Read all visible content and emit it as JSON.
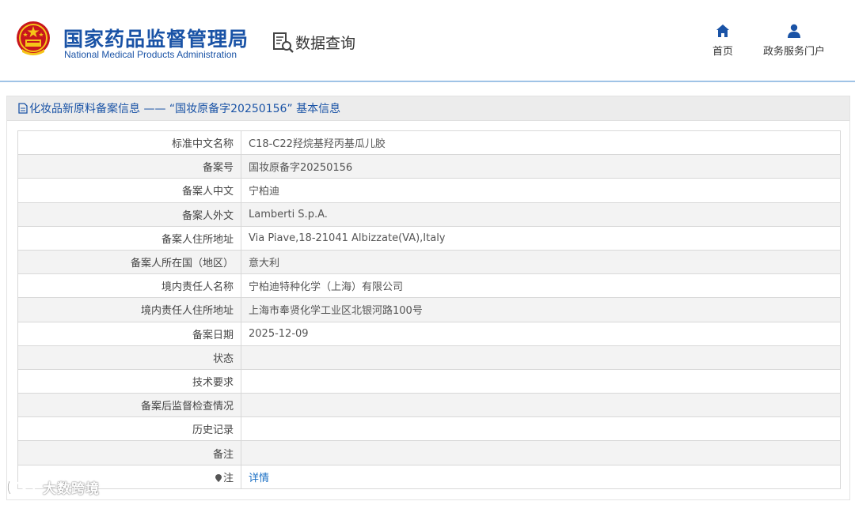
{
  "header": {
    "brand_cn": "国家药品监督管理局",
    "brand_en": "National Medical Products Administration",
    "query_label": "数据查询",
    "emblem_icon": "national-emblem",
    "query_icon": "document-search-icon",
    "nav": [
      {
        "label": "首页",
        "icon": "home-icon"
      },
      {
        "label": "政务服务门户",
        "icon": "user-icon"
      }
    ]
  },
  "section": {
    "title": "化妆品新原料备案信息 —— “国妆原备字20250156” 基本信息",
    "title_icon": "document-icon"
  },
  "rows": [
    {
      "label": "标准中文名称",
      "value": "C18-C22羟烷基羟丙基瓜儿胶"
    },
    {
      "label": "备案号",
      "value": "国妆原备字20250156"
    },
    {
      "label": "备案人中文",
      "value": "宁柏迪"
    },
    {
      "label": "备案人外文",
      "value": "Lamberti S.p.A."
    },
    {
      "label": "备案人住所地址",
      "value": "Via Piave,18-21041 Albizzate(VA),Italy"
    },
    {
      "label": "备案人所在国（地区）",
      "value": "意大利"
    },
    {
      "label": "境内责任人名称",
      "value": "宁柏迪特种化学（上海）有限公司"
    },
    {
      "label": "境内责任人住所地址",
      "value": "上海市奉贤化学工业区北银河路100号"
    },
    {
      "label": "备案日期",
      "value": "2025-12-09"
    },
    {
      "label": "状态",
      "value": ""
    },
    {
      "label": "技术要求",
      "value": ""
    },
    {
      "label": "备案后监督检查情况",
      "value": ""
    },
    {
      "label": "历史记录",
      "value": ""
    },
    {
      "label": "备注",
      "value": ""
    },
    {
      "label": "注",
      "value": "详情"
    }
  ],
  "watermark": "大数跨境",
  "colors": {
    "brand_blue": "#1a53a6",
    "link_blue": "#1a6fc4",
    "header_line": "#9fc3e6",
    "stripe": "#f3f3f3"
  }
}
